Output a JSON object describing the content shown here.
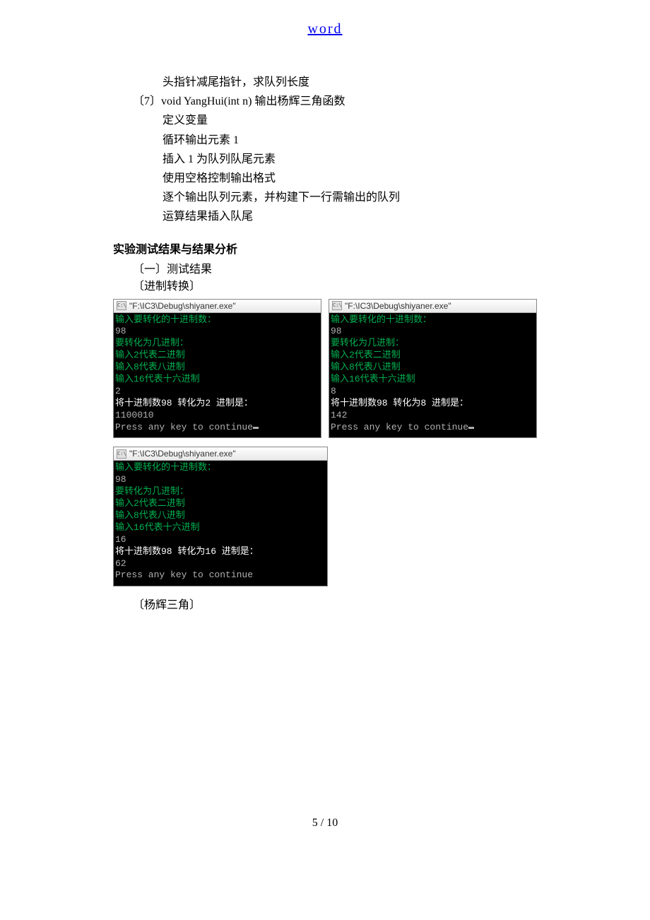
{
  "header_link": "word",
  "body_lines": {
    "l1": "头指针减尾指针，求队列长度",
    "l2": "〔7〕void YangHui(int n)  输出杨辉三角函数",
    "l3": "定义变量",
    "l4": "循环输出元素 1",
    "l5": "插入 1 为队列队尾元素",
    "l6": "使用空格控制输出格式",
    "l7": "逐个输出队列元素，并构建下一行需输出的队列",
    "l8": "运算结果插入队尾"
  },
  "section_heading": "实验测试结果与结果分析",
  "subline1": "〔一〕测试结果",
  "subline2": "〔进制转换〕",
  "terminals": {
    "title": "\"F:\\IC3\\Debug\\shiyaner.exe\"",
    "shared": {
      "prompt": "输入要转化的十进制数：",
      "input_num": "98",
      "ask_base": "要转化为几进制：",
      "opt2": "输入2代表二进制",
      "opt8": "输入8代表八进制",
      "opt16": "输入16代表十六进制",
      "press": "Press any key to continue"
    },
    "t1": {
      "base": "2",
      "result_line": "将十进制数98 转化为2 进制是：",
      "result": "1100010"
    },
    "t2": {
      "base": "8",
      "result_line": "将十进制数98 转化为8 进制是：",
      "result": "142"
    },
    "t3": {
      "base": "16",
      "result_line": "将十进制数98 转化为16 进制是：",
      "result": "62"
    }
  },
  "after_terminals": "〔杨辉三角〕",
  "footer": "5 / 10"
}
